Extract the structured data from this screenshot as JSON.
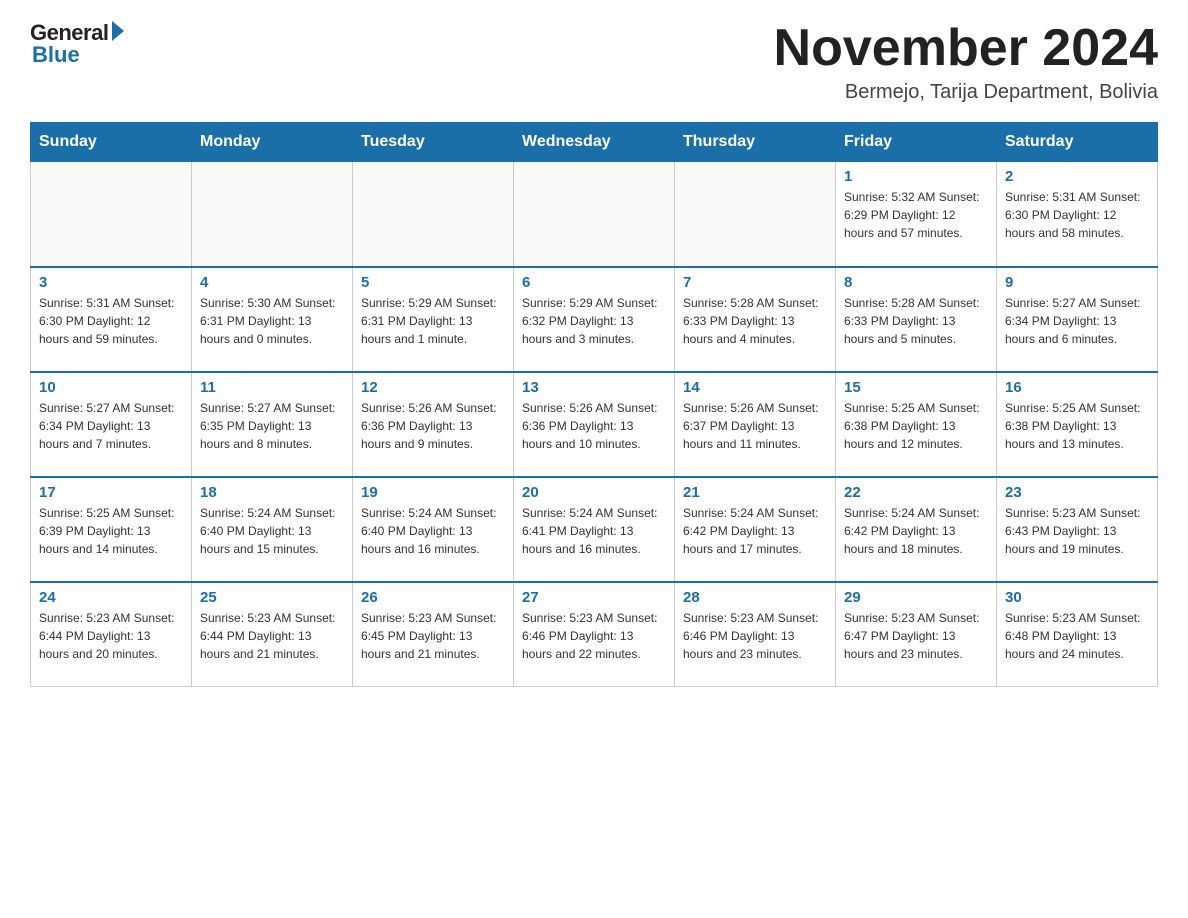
{
  "header": {
    "logo_general": "General",
    "logo_blue": "Blue",
    "month_title": "November 2024",
    "location": "Bermejo, Tarija Department, Bolivia"
  },
  "days_of_week": [
    "Sunday",
    "Monday",
    "Tuesday",
    "Wednesday",
    "Thursday",
    "Friday",
    "Saturday"
  ],
  "weeks": [
    [
      {
        "day": "",
        "info": ""
      },
      {
        "day": "",
        "info": ""
      },
      {
        "day": "",
        "info": ""
      },
      {
        "day": "",
        "info": ""
      },
      {
        "day": "",
        "info": ""
      },
      {
        "day": "1",
        "info": "Sunrise: 5:32 AM\nSunset: 6:29 PM\nDaylight: 12 hours and 57 minutes."
      },
      {
        "day": "2",
        "info": "Sunrise: 5:31 AM\nSunset: 6:30 PM\nDaylight: 12 hours and 58 minutes."
      }
    ],
    [
      {
        "day": "3",
        "info": "Sunrise: 5:31 AM\nSunset: 6:30 PM\nDaylight: 12 hours and 59 minutes."
      },
      {
        "day": "4",
        "info": "Sunrise: 5:30 AM\nSunset: 6:31 PM\nDaylight: 13 hours and 0 minutes."
      },
      {
        "day": "5",
        "info": "Sunrise: 5:29 AM\nSunset: 6:31 PM\nDaylight: 13 hours and 1 minute."
      },
      {
        "day": "6",
        "info": "Sunrise: 5:29 AM\nSunset: 6:32 PM\nDaylight: 13 hours and 3 minutes."
      },
      {
        "day": "7",
        "info": "Sunrise: 5:28 AM\nSunset: 6:33 PM\nDaylight: 13 hours and 4 minutes."
      },
      {
        "day": "8",
        "info": "Sunrise: 5:28 AM\nSunset: 6:33 PM\nDaylight: 13 hours and 5 minutes."
      },
      {
        "day": "9",
        "info": "Sunrise: 5:27 AM\nSunset: 6:34 PM\nDaylight: 13 hours and 6 minutes."
      }
    ],
    [
      {
        "day": "10",
        "info": "Sunrise: 5:27 AM\nSunset: 6:34 PM\nDaylight: 13 hours and 7 minutes."
      },
      {
        "day": "11",
        "info": "Sunrise: 5:27 AM\nSunset: 6:35 PM\nDaylight: 13 hours and 8 minutes."
      },
      {
        "day": "12",
        "info": "Sunrise: 5:26 AM\nSunset: 6:36 PM\nDaylight: 13 hours and 9 minutes."
      },
      {
        "day": "13",
        "info": "Sunrise: 5:26 AM\nSunset: 6:36 PM\nDaylight: 13 hours and 10 minutes."
      },
      {
        "day": "14",
        "info": "Sunrise: 5:26 AM\nSunset: 6:37 PM\nDaylight: 13 hours and 11 minutes."
      },
      {
        "day": "15",
        "info": "Sunrise: 5:25 AM\nSunset: 6:38 PM\nDaylight: 13 hours and 12 minutes."
      },
      {
        "day": "16",
        "info": "Sunrise: 5:25 AM\nSunset: 6:38 PM\nDaylight: 13 hours and 13 minutes."
      }
    ],
    [
      {
        "day": "17",
        "info": "Sunrise: 5:25 AM\nSunset: 6:39 PM\nDaylight: 13 hours and 14 minutes."
      },
      {
        "day": "18",
        "info": "Sunrise: 5:24 AM\nSunset: 6:40 PM\nDaylight: 13 hours and 15 minutes."
      },
      {
        "day": "19",
        "info": "Sunrise: 5:24 AM\nSunset: 6:40 PM\nDaylight: 13 hours and 16 minutes."
      },
      {
        "day": "20",
        "info": "Sunrise: 5:24 AM\nSunset: 6:41 PM\nDaylight: 13 hours and 16 minutes."
      },
      {
        "day": "21",
        "info": "Sunrise: 5:24 AM\nSunset: 6:42 PM\nDaylight: 13 hours and 17 minutes."
      },
      {
        "day": "22",
        "info": "Sunrise: 5:24 AM\nSunset: 6:42 PM\nDaylight: 13 hours and 18 minutes."
      },
      {
        "day": "23",
        "info": "Sunrise: 5:23 AM\nSunset: 6:43 PM\nDaylight: 13 hours and 19 minutes."
      }
    ],
    [
      {
        "day": "24",
        "info": "Sunrise: 5:23 AM\nSunset: 6:44 PM\nDaylight: 13 hours and 20 minutes."
      },
      {
        "day": "25",
        "info": "Sunrise: 5:23 AM\nSunset: 6:44 PM\nDaylight: 13 hours and 21 minutes."
      },
      {
        "day": "26",
        "info": "Sunrise: 5:23 AM\nSunset: 6:45 PM\nDaylight: 13 hours and 21 minutes."
      },
      {
        "day": "27",
        "info": "Sunrise: 5:23 AM\nSunset: 6:46 PM\nDaylight: 13 hours and 22 minutes."
      },
      {
        "day": "28",
        "info": "Sunrise: 5:23 AM\nSunset: 6:46 PM\nDaylight: 13 hours and 23 minutes."
      },
      {
        "day": "29",
        "info": "Sunrise: 5:23 AM\nSunset: 6:47 PM\nDaylight: 13 hours and 23 minutes."
      },
      {
        "day": "30",
        "info": "Sunrise: 5:23 AM\nSunset: 6:48 PM\nDaylight: 13 hours and 24 minutes."
      }
    ]
  ]
}
